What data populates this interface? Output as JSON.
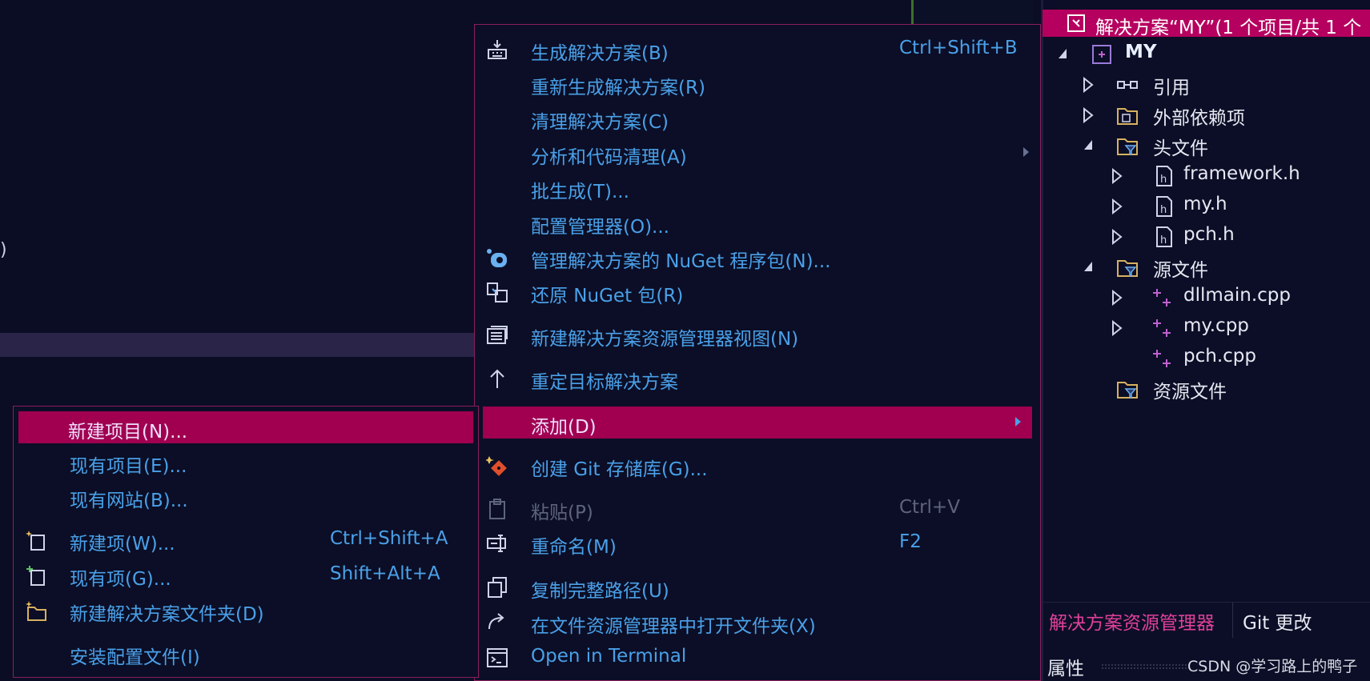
{
  "main_menu": {
    "items": [
      {
        "label": "生成解决方案(B)",
        "shortcut": "Ctrl+Shift+B",
        "icon": "build-icon"
      },
      {
        "label": "重新生成解决方案(R)",
        "shortcut": ""
      },
      {
        "label": "清理解决方案(C)",
        "shortcut": ""
      },
      {
        "label": "分析和代码清理(A)",
        "shortcut": ""
      },
      {
        "label": "批生成(T)...",
        "shortcut": ""
      },
      {
        "label": "配置管理器(O)...",
        "shortcut": ""
      },
      {
        "label": "管理解决方案的 NuGet 程序包(N)...",
        "shortcut": "",
        "icon": "nuget-icon"
      },
      {
        "label": "还原 NuGet 包(R)",
        "shortcut": "",
        "icon": "restore-icon"
      },
      {
        "label": "新建解决方案资源管理器视图(N)",
        "shortcut": "",
        "icon": "new-view-icon"
      },
      {
        "label": "重定目标解决方案",
        "shortcut": "",
        "icon": "retarget-icon"
      },
      {
        "label": "添加(D)",
        "shortcut": "",
        "highlighted": true
      },
      {
        "label": "创建 Git 存储库(G)...",
        "shortcut": "",
        "icon": "git-icon"
      },
      {
        "label": "粘贴(P)",
        "shortcut": "Ctrl+V",
        "disabled": true,
        "icon": "paste-icon"
      },
      {
        "label": "重命名(M)",
        "shortcut": "F2",
        "icon": "rename-icon"
      },
      {
        "label": "复制完整路径(U)",
        "shortcut": "",
        "icon": "copy-icon"
      },
      {
        "label": "在文件资源管理器中打开文件夹(X)",
        "shortcut": "",
        "icon": "open-folder-icon"
      },
      {
        "label": "Open in Terminal",
        "shortcut": "",
        "icon": "terminal-icon"
      }
    ]
  },
  "sub_menu": {
    "items": [
      {
        "label": "新建项目(N)...",
        "shortcut": "",
        "highlighted": true
      },
      {
        "label": "现有项目(E)...",
        "shortcut": ""
      },
      {
        "label": "现有网站(B)...",
        "shortcut": ""
      },
      {
        "label": "新建项(W)...",
        "shortcut": "Ctrl+Shift+A",
        "icon": "new-item-icon"
      },
      {
        "label": "现有项(G)...",
        "shortcut": "Shift+Alt+A",
        "icon": "existing-item-icon"
      },
      {
        "label": "新建解决方案文件夹(D)",
        "shortcut": "",
        "icon": "new-folder-icon"
      },
      {
        "label": "安装配置文件(I)",
        "shortcut": ""
      }
    ]
  },
  "solution_explorer": {
    "title": "解决方案“MY”(1 个项目/共 1 个",
    "nodes": [
      {
        "label": "MY",
        "bold": true
      },
      {
        "label": "引用"
      },
      {
        "label": "外部依赖项"
      },
      {
        "label": "头文件"
      },
      {
        "label": "framework.h"
      },
      {
        "label": "my.h"
      },
      {
        "label": "pch.h"
      },
      {
        "label": "源文件"
      },
      {
        "label": "dllmain.cpp"
      },
      {
        "label": "my.cpp"
      },
      {
        "label": "pch.cpp"
      },
      {
        "label": "资源文件"
      }
    ],
    "tabs": {
      "explorer": "解决方案资源管理器",
      "git": "Git 更改"
    },
    "properties": "属性"
  },
  "watermark": "CSDN @学习路上的鸭子",
  "editor": {
    "paren": ")"
  },
  "colors": {
    "accent": "#a0004f",
    "text": "#4aa0e8",
    "title_bar": "#b6005f"
  }
}
